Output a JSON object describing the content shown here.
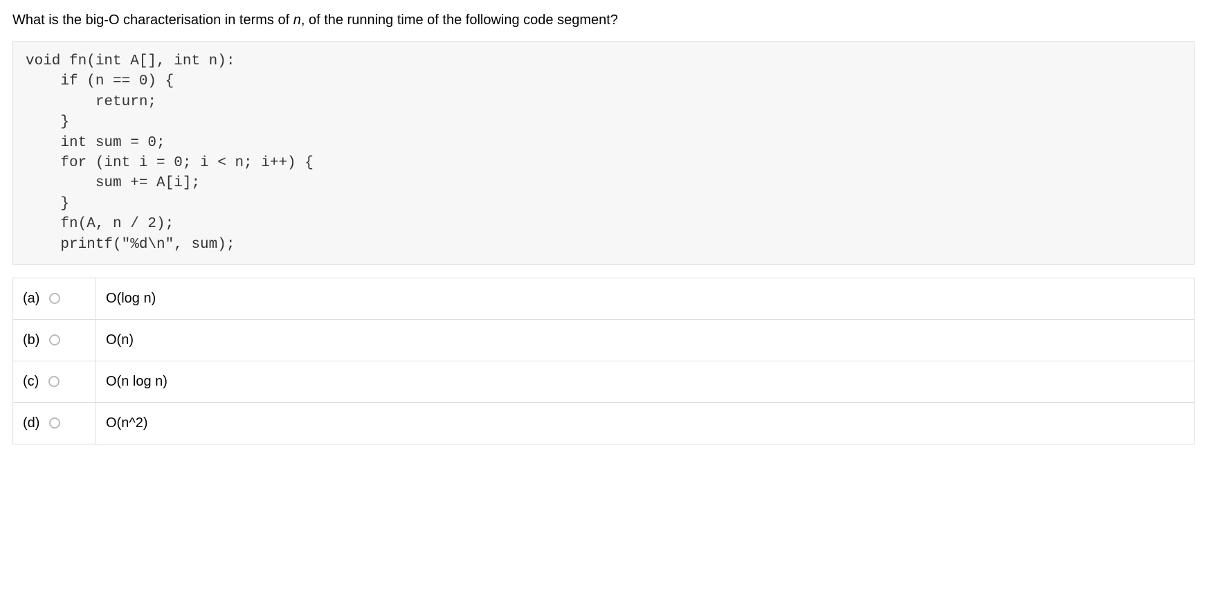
{
  "question": {
    "prefix": "What is the big-O characterisation in terms of ",
    "var": "n",
    "suffix": ", of the running time of the following code segment?"
  },
  "code": "void fn(int A[], int n):\n    if (n == 0) {\n        return;\n    }\n    int sum = 0;\n    for (int i = 0; i < n; i++) {\n        sum += A[i];\n    }\n    fn(A, n / 2);\n    printf(\"%d\\n\", sum);",
  "options": [
    {
      "label": "(a)",
      "text": "O(log n)"
    },
    {
      "label": "(b)",
      "text": "O(n)"
    },
    {
      "label": "(c)",
      "text": "O(n log n)"
    },
    {
      "label": "(d)",
      "text": "O(n^2)"
    }
  ]
}
